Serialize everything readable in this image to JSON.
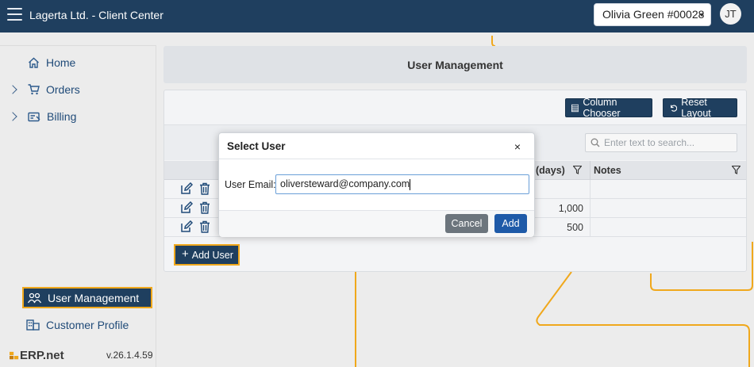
{
  "header": {
    "title": "Lagerta Ltd. - Client Center",
    "user_selector": "Olivia Green #00028",
    "avatar_initials": "JT"
  },
  "sidebar": {
    "items": [
      {
        "label": "Home",
        "icon": "home-icon"
      },
      {
        "label": "Orders",
        "icon": "cart-icon"
      },
      {
        "label": "Billing",
        "icon": "invoice-icon"
      },
      {
        "label": "User Management",
        "icon": "users-icon",
        "active": true
      },
      {
        "label": "Customer Profile",
        "icon": "building-icon"
      }
    ],
    "brand": "ERP.net",
    "version": "v.26.1.4.59"
  },
  "main": {
    "page_title": "User Management",
    "column_chooser_label": "Column Chooser",
    "reset_layout_label": "Reset Layout",
    "search_placeholder": "Enter text to search...",
    "columns": [
      "(days)",
      "Notes"
    ],
    "rows": [
      {
        "days": "",
        "notes": ""
      },
      {
        "days": "1,000",
        "notes": ""
      },
      {
        "days": "500",
        "notes": ""
      }
    ],
    "add_user_label": "Add User"
  },
  "modal": {
    "title": "Select User",
    "close_symbol": "×",
    "field_label": "User Email:",
    "field_value": "oliversteward@company.com",
    "cancel_label": "Cancel",
    "add_label": "Add"
  },
  "colors": {
    "header_bg": "#1f3f5f",
    "highlight": "#f0a81c",
    "primary": "#1e5aa8",
    "secondary": "#6c757d"
  }
}
